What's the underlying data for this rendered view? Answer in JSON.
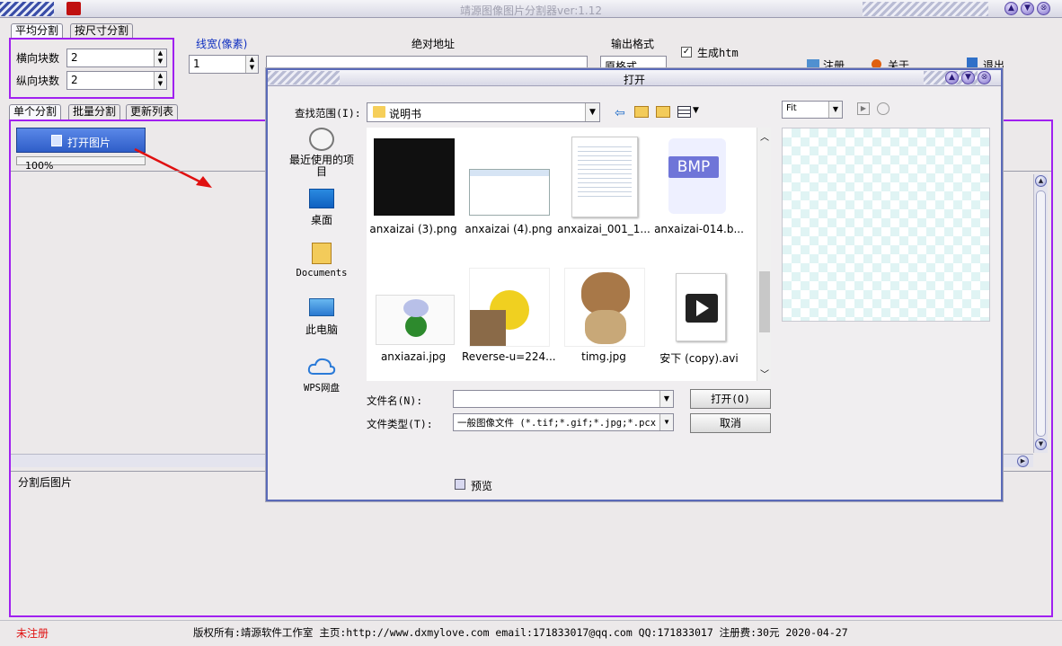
{
  "window": {
    "title": "靖源图像图片分割器ver:1.12",
    "controls": [
      "▲",
      "▼",
      "⊗"
    ]
  },
  "split_tabs": [
    "平均分割",
    "按尺寸分割"
  ],
  "grid": {
    "horizontal_label": "横向块数",
    "horizontal_value": "2",
    "vertical_label": "纵向块数",
    "vertical_value": "2"
  },
  "line_width": {
    "label": "线宽(像素)",
    "value": "1"
  },
  "abs_path": {
    "label": "绝对地址",
    "value": ""
  },
  "output_format": {
    "label": "输出格式",
    "value": "原格式"
  },
  "options": {
    "gen_htm": "生成htm",
    "gen_htm_checked": true
  },
  "actions": {
    "register": "注册",
    "about": "关于",
    "exit": "退出"
  },
  "mode_tabs": [
    "单个分割",
    "批量分割",
    "更新列表"
  ],
  "open_image_button": "打开图片",
  "zoom_label": "100%",
  "after_split_label": "分割后图片",
  "status": {
    "unregistered": "未注册",
    "info": "版权所有:靖源软件工作室 主页:http://www.dxmylove.com email:171833017@qq.com QQ:171833017 注册费:30元 2020-04-27"
  },
  "dialog": {
    "title": "打开",
    "lookin_label": "查找范围(I):",
    "lookin_value": "说明书",
    "nav": [
      "最近使用的项目",
      "桌面",
      "Documents",
      "此电脑",
      "WPS网盘"
    ],
    "files": [
      {
        "name": "anxaizai (3).png",
        "kind": "terminal"
      },
      {
        "name": "anxaizai (4).png",
        "kind": "window"
      },
      {
        "name": "anxaizai_001_1...",
        "kind": "doc"
      },
      {
        "name": "anxaizai-014.b...",
        "kind": "bmp"
      },
      {
        "name": "anxiazai.jpg",
        "kind": "sticker"
      },
      {
        "name": "Reverse-u=224...",
        "kind": "cat"
      },
      {
        "name": "timg.jpg",
        "kind": "dog"
      },
      {
        "name": "安下 (copy).avi",
        "kind": "video"
      }
    ],
    "bmp_text": "BMP",
    "filename_label": "文件名(N):",
    "filename_value": "",
    "filetype_label": "文件类型(T):",
    "filetype_value": "一般图像文件 (*.tif;*.gif;*.jpg;*.pcx",
    "open_button": "打开(O)",
    "cancel_button": "取消",
    "preview_label": "预览",
    "fit_value": "Fit"
  },
  "colors": {
    "accent": "#a020f0",
    "brand_blue": "#3a6fd8",
    "status_red": "#e01010",
    "link_blue": "#1030c0"
  }
}
